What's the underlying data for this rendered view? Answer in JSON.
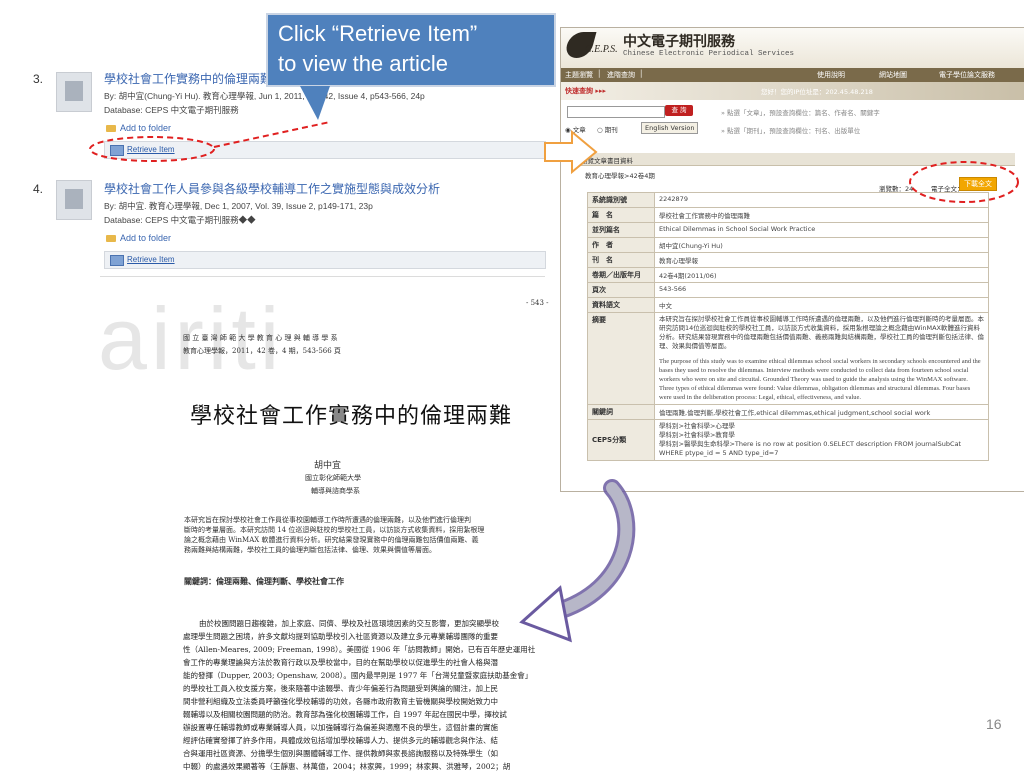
{
  "callout": {
    "line1": "Click “Retrieve Item”",
    "line2": "to view the article"
  },
  "results": [
    {
      "num": "3.",
      "title": "學校社會工作實務中的倫理兩難",
      "byline": "By: 胡中宜(Chung-Yi Hu). 教育心理學報, Jun 1, 2011, Vol. 42, Issue 4, p543-566, 24p",
      "database": "Database: CEPS 中文電子期刊服務",
      "folder": "Add to folder",
      "retrieve": "Retrieve Item"
    },
    {
      "num": "4.",
      "title": "學校社會工作人員參與各級學校輔導工作之實施型態與成效分析",
      "byline": "By: 胡中宜. 教育心理學報, Dec 1, 2007, Vol. 39, Issue 2, p149-171, 23p",
      "database": "Database: CEPS 中文電子期刊服務◆◆",
      "folder": "Add to folder",
      "retrieve": "Retrieve Item"
    }
  ],
  "article": {
    "watermark": "airiti",
    "page": "- 543 -",
    "hdr1": "國 立 臺 灣 師 範 大 學 教 育 心 理 與 輔 導 學 系",
    "hdr2": "教育心理學報，2011，42 卷，4 期，543-566 頁",
    "title": "學校社會工作實務中的倫理兩難",
    "author": "胡中宜",
    "aff1": "國立彰化師範大學",
    "aff2": "輔導與諮商學系",
    "abstract": [
      "本研究旨在探討學校社會工作員從事校園輔導工作時所遭遇的倫理兩難，以及他們進行倫理判",
      "斷時的考量層面。本研究訪問 14 位巡迴與駐校的學校社工員，以訪談方式收集資料，採用紮根理",
      "論之概念藉由 WinMAX 軟體進行資料分析。研究結果發現實務中的倫理兩難包括價值兩難、義",
      "務兩難與結構兩難，學校社工員的倫理判斷包括法律、倫理、效果與價值等層面。"
    ],
    "keywords": "關鍵詞：倫理兩難、倫理判斷、學校社會工作",
    "body": [
      "由於校園問題日趨複雜，加上家庭、同儕、學校及社區環境因素的交互影響，更加突顯學校",
      "處理學生問題之困境，許多文獻均提到協助學校引入社區資源以及建立多元專業輔導團隊的重要",
      "性（Allen-Meares, 2009; Freeman, 1998）。美國從 1906 年「訪問教師」開始，已有百年歷史運用社",
      "會工作的專業理論與方法於教育行政以及學校當中，目的在幫助學校以促進學生的社會人格與潛",
      "能的發揮（Dupper, 2003; Openshaw, 2008）。國內最早則是 1977 年「台灣兒童暨家庭扶助基金會」",
      "的學校社工員入校支援方案，後來隨著中途輟學、青少年偏差行為問題受到輿論的關注，加上民",
      "間非營利組織及立法委員呼籲強化學校輔導的功效，各縣市政府教育主管機關與學校開始致力中",
      "輟輔導以及相關校園問題的防治。教育部為強化校園輔導工作，自 1997 年起在國民中學，擇校試",
      "辦設置專任輔導教師或專業輔導人員，以加強輔導行為偏差與適應不良的學生，這個計畫的實施",
      "經評估確實發揮了許多作用，具體成效包括增加學校輔導人力、提供多元的輔導觀念與作法、結",
      "合與運用社區資源、分擔學生個別與團體輔導工作、提供教師與家長諮詢服務以及特殊學生（如",
      "中輟）的處遇效果顯著等（王靜惠、林萬億，2004；林家興，1999；林家興、洪雅琴，2002；胡"
    ]
  },
  "ceps": {
    "logo_letters": "C.E.P.S.",
    "logo_cn": "中文電子期刊服務",
    "logo_en": "Chinese Electronic Periodical Services",
    "nav": [
      "主題瀏覽",
      "│",
      "進階查詢",
      "│",
      "使用說明",
      "網站地圖",
      "電子學位論文服務"
    ],
    "quick": "快速查詢 ▸▸▸",
    "ip": "您好！您的IP位址是：202.45.48.218",
    "query_btn": "查 詢",
    "hint1": "» 點選「文章」，預設查詢欄位：篇名、作者名、關鍵字",
    "hint2": "» 點選「期刊」，預設查詢欄位：刊名、出版單位",
    "radio1": "文章",
    "radio2": "期刊",
    "english_btn": "English Version",
    "browse": "瀏覽文章書目資料",
    "crumb": "教育心理學報>42卷4期",
    "views": "瀏覽數：24",
    "efull": "電子全文：",
    "download": "下載全文",
    "rows": [
      {
        "k": "系統識別號",
        "v": "2242879"
      },
      {
        "k": "篇　名",
        "v": "學校社會工作實務中的倫理兩難"
      },
      {
        "k": "並列篇名",
        "v": "Ethical Dilemmas in School Social Work Practice"
      },
      {
        "k": "作　者",
        "v": "胡中宜(Chung-Yi Hu)"
      },
      {
        "k": "刊　名",
        "v": "教育心理學報"
      },
      {
        "k": "卷期／出版年月",
        "v": "42卷4期(2011/06)"
      },
      {
        "k": "頁次",
        "v": "543-566"
      },
      {
        "k": "資料語文",
        "v": "中文"
      }
    ],
    "abstract_label": "摘要",
    "abstract_cn": "本研究旨在探討學校社會工作員從事校園輔導工作時所遭遇的倫理兩難，以及他們進行倫理判斷時的考量層面。本研究訪問14位巡迴與駐校的學校社工員，以訪談方式收集資料，採用紮根理論之概念藉由WinMAX軟體進行資料分析。研究結果發現實務中的倫理兩難包括價值兩難、義務兩難與結構兩難，學校社工員的倫理判斷包括法律、倫理、效果與價值等層面。",
    "abstract_en": "The purpose of this study was to examine ethical dilemmas school social workers in secondary schools encountered and the bases they used to resolve the dilemmas. Interview methods were conducted to collect data from fourteen school social workers who were on site and circuital. Grounded Theory was used to guide the analysis using the WinMAX software. Three types of ethical dilemmas were found: Value dilemmas, obligation dilemmas and structural dilemmas. Four bases were used in the deliberation process: Legal, ethical, effectiveness, and value.",
    "kw_label": "關鍵詞",
    "kw": "倫理兩難,倫理判斷,學校社會工作,ethical dilemmas,ethical judgment,school social work",
    "cat_label": "CEPS分類",
    "cat1": "學科別>社會科學>心理學",
    "cat2": "學科別>社會科學>教育學",
    "cat3": "學科別>醫學與生命科學>There is no row at position 0.SELECT description FROM journalSubCat WHERE ptype_id = 5 AND type_id=7"
  },
  "slide_number": "16"
}
